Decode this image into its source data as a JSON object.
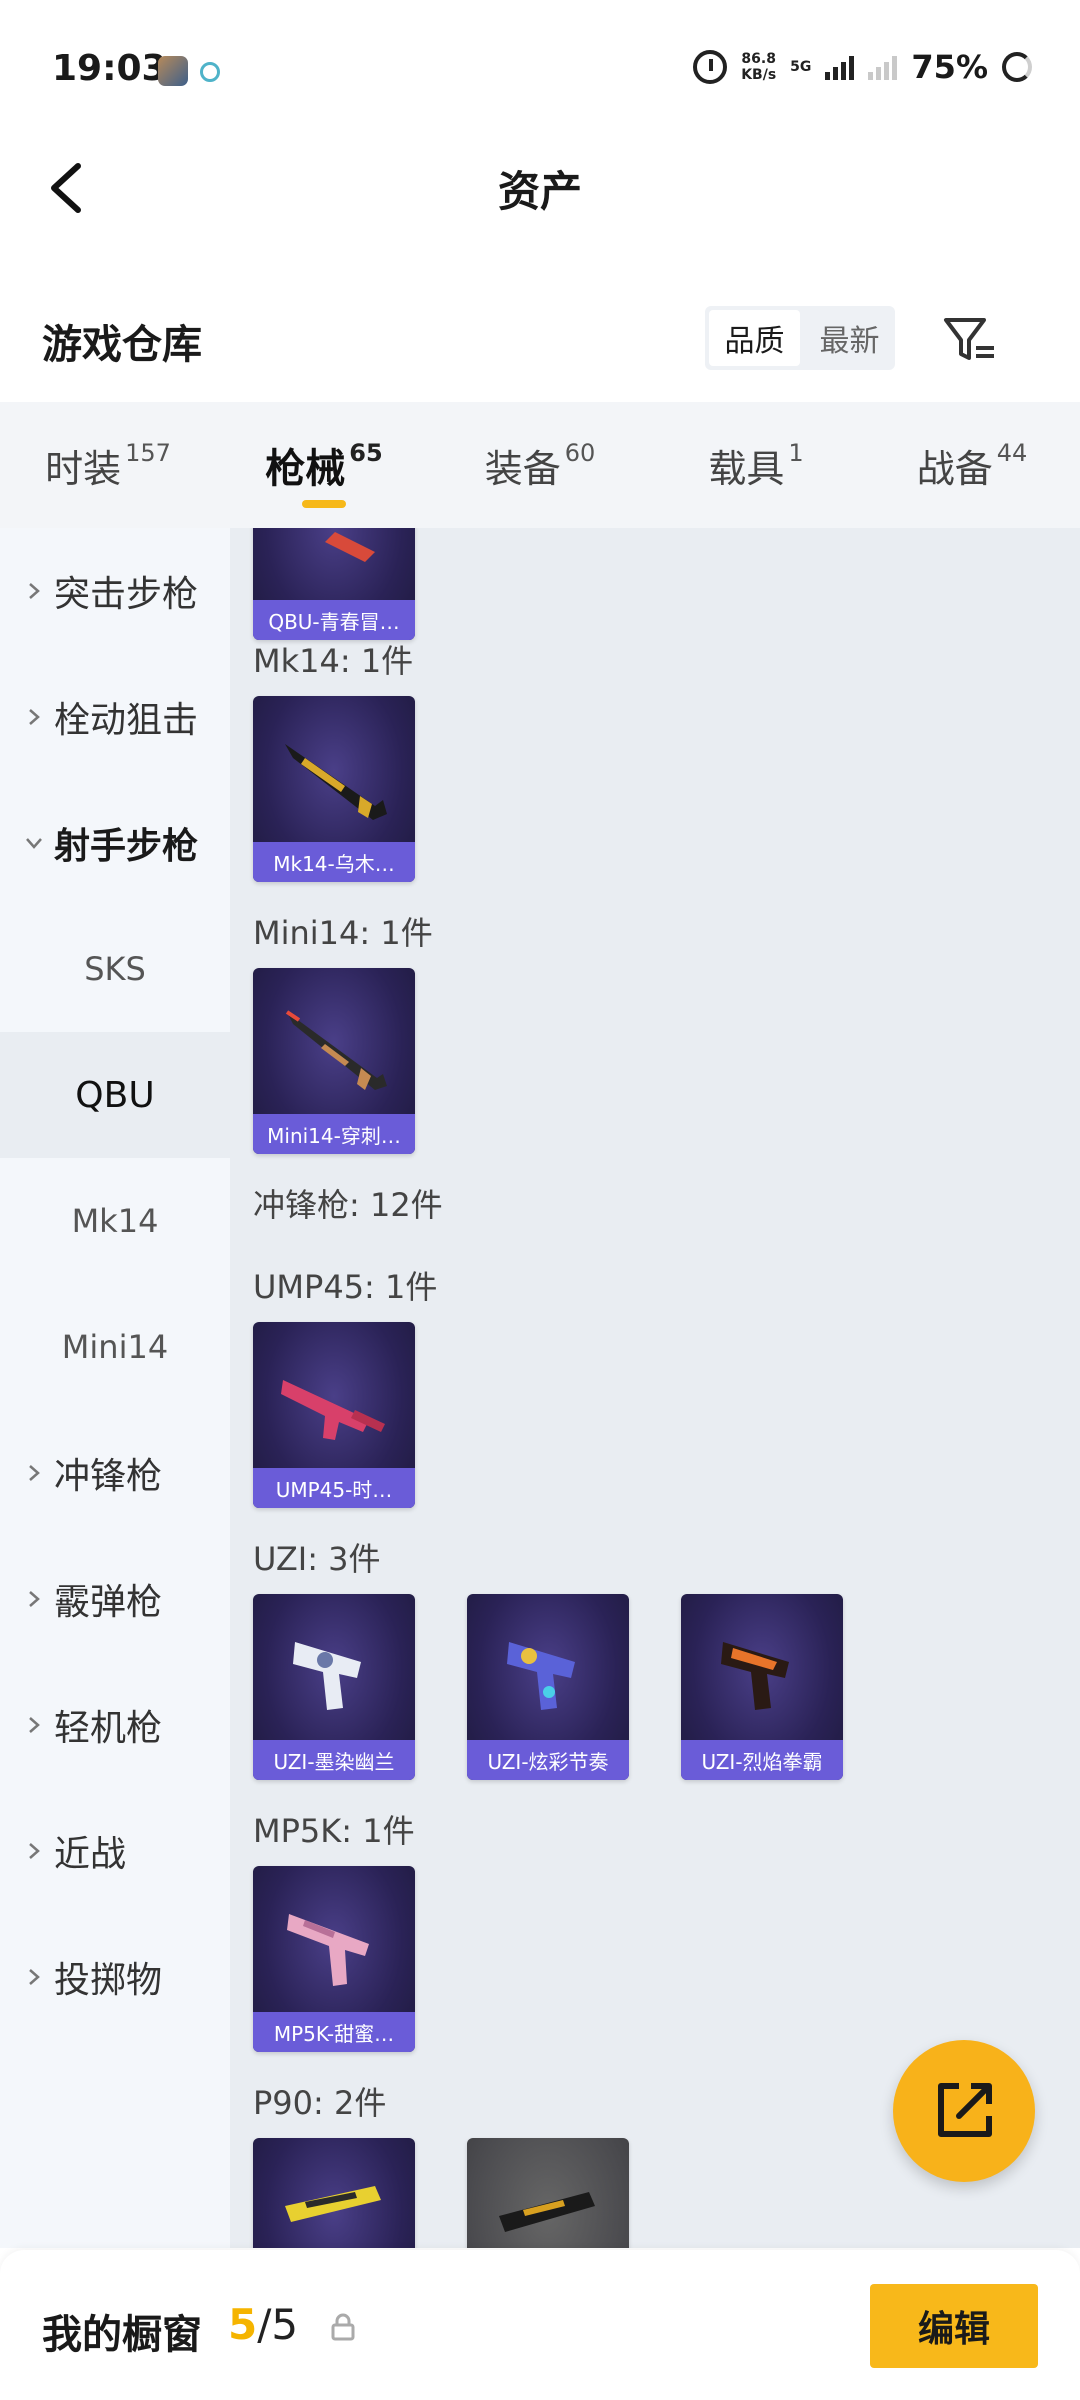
{
  "status_bar": {
    "time": "19:03",
    "net_speed": "86.8",
    "net_unit": "KB/s",
    "network": "5G",
    "battery": "75%"
  },
  "nav": {
    "title": "资产"
  },
  "warehouse": {
    "title": "游戏仓库",
    "sort": {
      "options": [
        "品质",
        "最新"
      ],
      "selected": "品质"
    }
  },
  "tabs": [
    {
      "label": "时装",
      "count": "157"
    },
    {
      "label": "枪械",
      "count": "65"
    },
    {
      "label": "装备",
      "count": "60"
    },
    {
      "label": "载具",
      "count": "1"
    },
    {
      "label": "战备",
      "count": "44"
    }
  ],
  "sidebar": {
    "categories": [
      "突击步枪",
      "栓动狙击",
      "射手步枪",
      "冲锋枪",
      "霰弹枪",
      "轻机枪",
      "近战",
      "投掷物"
    ],
    "sub_items": [
      "SKS",
      "QBU",
      "Mk14",
      "Mini14"
    ]
  },
  "content": {
    "top_card": "QBU-青春冒…",
    "groups": [
      {
        "label": "Mk14: 1件",
        "cards": [
          "Mk14-乌木…"
        ]
      },
      {
        "label": "Mini14: 1件",
        "cards": [
          "Mini14-穿刺…"
        ]
      },
      {
        "label": "冲锋枪: 12件"
      },
      {
        "label": "UMP45: 1件",
        "cards": [
          "UMP45-时…"
        ]
      },
      {
        "label": "UZI: 3件",
        "cards": [
          "UZI-墨染幽兰",
          "UZI-炫彩节奏",
          "UZI-烈焰拳霸"
        ]
      },
      {
        "label": "MP5K: 1件",
        "cards": [
          "MP5K-甜蜜…"
        ]
      },
      {
        "label": "P90: 2件"
      }
    ]
  },
  "bottom": {
    "label": "我的橱窗",
    "count_current": "5",
    "count_sep": "/5",
    "edit": "编辑"
  },
  "colors": {
    "accent": "#f8b81a",
    "card_caption": "#6a5cd8",
    "card_bg": "#2a2256"
  },
  "icons": [
    "back-icon",
    "filter-icon",
    "chevron-right-icon",
    "chevron-down-icon",
    "share-icon",
    "lock-icon",
    "alarm-icon"
  ]
}
